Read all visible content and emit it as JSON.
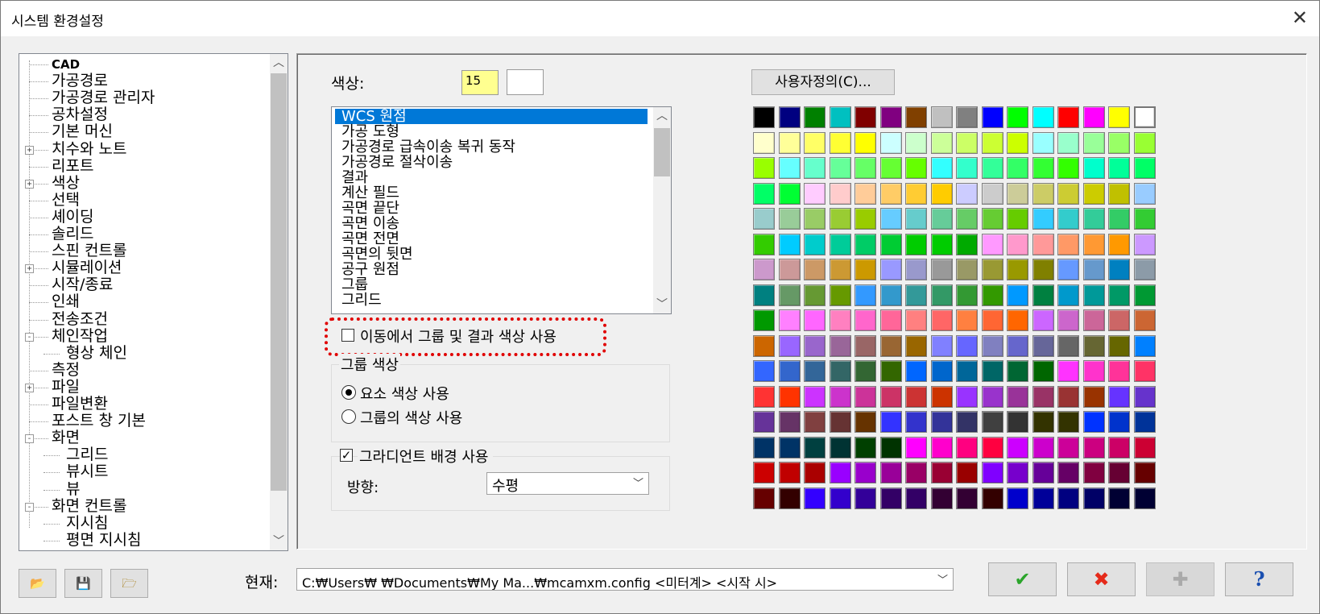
{
  "window": {
    "title": "시스템 환경설정",
    "close_glyph": "✕"
  },
  "tree": {
    "items": [
      {
        "label": "CAD"
      },
      {
        "label": "가공경로"
      },
      {
        "label": "가공경로 관리자"
      },
      {
        "label": "공차설정"
      },
      {
        "label": "기본 머신"
      },
      {
        "label": "치수와 노트"
      },
      {
        "label": "리포트"
      },
      {
        "label": "색상"
      },
      {
        "label": "선택"
      },
      {
        "label": "셰이딩"
      },
      {
        "label": "솔리드"
      },
      {
        "label": "스핀 컨트롤"
      },
      {
        "label": "시뮬레이션"
      },
      {
        "label": "시작/종료"
      },
      {
        "label": "인쇄"
      },
      {
        "label": "전송조건"
      },
      {
        "label": "체인작업"
      },
      {
        "label": "형상 체인"
      },
      {
        "label": "측정"
      },
      {
        "label": "파일"
      },
      {
        "label": "파일변환"
      },
      {
        "label": "포스트 창 기본"
      },
      {
        "label": "화면"
      },
      {
        "label": "그리드"
      },
      {
        "label": "뷰시트"
      },
      {
        "label": "뷰"
      },
      {
        "label": "화면 컨트롤"
      },
      {
        "label": "지시침"
      },
      {
        "label": "평면 지시침"
      }
    ]
  },
  "color_panel": {
    "color_label": "색상:",
    "color_number": "15",
    "items": [
      "WCS 원점",
      "가공 도형",
      "가공경로 급속이송 복귀 동작",
      "가공경로 절삭이송",
      "결과",
      "계산 필드",
      "곡면 끝단",
      "곡면 이송",
      "곡면 전면",
      "곡면의 뒷면",
      "공구 원점",
      "그룹",
      "그리드"
    ],
    "use_group_result_label": "이동에서 그룹 및 결과 색상 사용",
    "group_color_title": "그룹 색상",
    "radio_element": "요소 색상 사용",
    "radio_group": "그룹의 색상 사용",
    "gradient_label": "그라디언트 배경 사용",
    "direction_label": "방향:",
    "direction_value": "수평",
    "custom_button": "사용자정의(C)..."
  },
  "palette": [
    "#000000",
    "#000080",
    "#008000",
    "#00c0c0",
    "#800000",
    "#800080",
    "#804000",
    "#c0c0c0",
    "#808080",
    "#0000ff",
    "#00ff00",
    "#00ffff",
    "#ff0000",
    "#ff00ff",
    "#ffff00",
    "#ffffff",
    "#ffffcc",
    "#ffff99",
    "#ffff66",
    "#ffff33",
    "#ffff00",
    "#ccffff",
    "#ccffcc",
    "#ccff99",
    "#ccff66",
    "#ccff33",
    "#ccff00",
    "#99ffff",
    "#99ffcc",
    "#99ff99",
    "#99ff66",
    "#99ff33",
    "#99ff00",
    "#66ffff",
    "#66ffcc",
    "#66ff99",
    "#66ff66",
    "#66ff33",
    "#66ff00",
    "#33ffff",
    "#33ffcc",
    "#33ff99",
    "#33ff66",
    "#33ff33",
    "#33ff00",
    "#00ffcc",
    "#00ff99",
    "#00ff66",
    "#00ff66",
    "#00ff33",
    "#ffccff",
    "#ffcccc",
    "#ffcc99",
    "#ffcc66",
    "#ffcc33",
    "#ffcc00",
    "#ccccff",
    "#cccccc",
    "#cccc99",
    "#cccc66",
    "#cccc33",
    "#cccc00",
    "#c0c000",
    "#99ccff",
    "#99cccc",
    "#99cc99",
    "#99cc66",
    "#99cc33",
    "#99cc00",
    "#66ccff",
    "#66cccc",
    "#66cc99",
    "#66cc66",
    "#66cc33",
    "#66cc00",
    "#33ccff",
    "#33cccc",
    "#33cc99",
    "#33cc66",
    "#33cc33",
    "#33cc00",
    "#00ccff",
    "#00cccc",
    "#00cc99",
    "#00cc66",
    "#00cc33",
    "#00cc00",
    "#00cc00",
    "#00aa00",
    "#ff99ff",
    "#ff99cc",
    "#ff9999",
    "#ff9966",
    "#ff9933",
    "#ff9900",
    "#cc99ff",
    "#cc99cc",
    "#cc9999",
    "#cc9966",
    "#cc9933",
    "#cc9900",
    "#9999ff",
    "#9999cc",
    "#999999",
    "#999966",
    "#999933",
    "#999900",
    "#808000",
    "#6699ff",
    "#6699cc",
    "#0080c0",
    "#8c9ba8",
    "#008080",
    "#669966",
    "#669933",
    "#669900",
    "#3399ff",
    "#3399cc",
    "#339999",
    "#339966",
    "#339933",
    "#339900",
    "#0099ff",
    "#008040",
    "#0099cc",
    "#009999",
    "#009966",
    "#009933",
    "#009900",
    "#ff80ff",
    "#ff66ff",
    "#ff80c0",
    "#ff66cc",
    "#ff6699",
    "#ff8080",
    "#ff6666",
    "#ff8040",
    "#ff6633",
    "#ff6600",
    "#cc66ff",
    "#cc66cc",
    "#cc6699",
    "#cc6666",
    "#cc6633",
    "#cc6600",
    "#9966ff",
    "#9966cc",
    "#996699",
    "#996666",
    "#996633",
    "#996600",
    "#8080ff",
    "#6666ff",
    "#8080c0",
    "#6666cc",
    "#666699",
    "#666666",
    "#666633",
    "#666600",
    "#0080ff",
    "#3366ff",
    "#3366cc",
    "#336699",
    "#336666",
    "#336633",
    "#336600",
    "#0066ff",
    "#0066cc",
    "#006699",
    "#006666",
    "#006633",
    "#006600",
    "#ff33ff",
    "#ff33cc",
    "#ff3399",
    "#ff3366",
    "#ff3333",
    "#ff3300",
    "#cc33ff",
    "#cc33cc",
    "#cc3399",
    "#cc3366",
    "#cc3333",
    "#cc3300",
    "#9933ff",
    "#9933cc",
    "#993399",
    "#993366",
    "#993333",
    "#993300",
    "#6633ff",
    "#6633cc",
    "#663399",
    "#663366",
    "#804040",
    "#663333",
    "#663300",
    "#3333ff",
    "#3333cc",
    "#333399",
    "#333366",
    "#404040",
    "#333333",
    "#333300",
    "#333300",
    "#0033ff",
    "#0033cc",
    "#003399",
    "#003366",
    "#003366",
    "#004040",
    "#003333",
    "#004000",
    "#003300",
    "#ff00ff",
    "#ff00cc",
    "#ff0080",
    "#ff0040",
    "#cc00ff",
    "#cc00cc",
    "#cc0099",
    "#cc0080",
    "#cc0066",
    "#cc0033",
    "#cc0000",
    "#c00000",
    "#aa0000",
    "#9900ff",
    "#9900cc",
    "#990099",
    "#990066",
    "#990033",
    "#990000",
    "#8000ff",
    "#7700cc",
    "#660099",
    "#660066",
    "#800040",
    "#660033",
    "#660000",
    "#660000",
    "#330000",
    "#3300ff",
    "#3300cc",
    "#330099",
    "#330066",
    "#330066",
    "#330033",
    "#330033",
    "#330000",
    "#0000cc",
    "#000099",
    "#000080",
    "#000066",
    "#000033",
    "#000033"
  ],
  "footer": {
    "current_label": "현재:",
    "current_path": "C:₩Users₩                    ₩Documents₩My Ma...₩mcamxm.config <미터계> <시작 시>",
    "ok_glyph": "✔",
    "cancel_glyph": "✖",
    "add_glyph": "✚",
    "help_glyph": "?"
  },
  "colors": {
    "selection": "#0078d7",
    "highlight_box": "#e00000",
    "ok": "#2ba52b",
    "cancel": "#e52a1a"
  }
}
